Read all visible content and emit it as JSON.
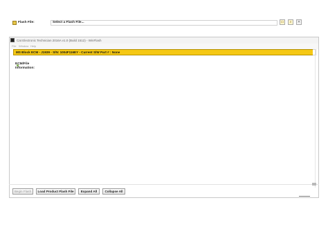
{
  "window": {
    "title": "Cat Electronic Technician 2016A v1.0 (Build 1512) - WinFlash"
  },
  "menu": {
    "file": "File",
    "window": "Window",
    "help": "Help"
  },
  "ecm_header": {
    "text": "MS Block ECM - J1939 - S/N: 1004F116EY - Current S/W Part # : None"
  },
  "flash_file": {
    "label": "Flash File:",
    "value": "Select a Flash File..."
  },
  "toolbar_icons": [
    "folder-icon",
    "search-icon",
    "close-icon"
  ],
  "ecm_file_info": {
    "label": "ECM/File Information:"
  },
  "footer_buttons": {
    "begin_flash": "Begin Flash",
    "load_product_flash_file": "Load Product Flash File",
    "expand_all": "Expand All",
    "collapse_all": "Collapse All"
  },
  "colors": {
    "header_yellow": "#f5c814",
    "accent_green": "#7fb04d"
  }
}
